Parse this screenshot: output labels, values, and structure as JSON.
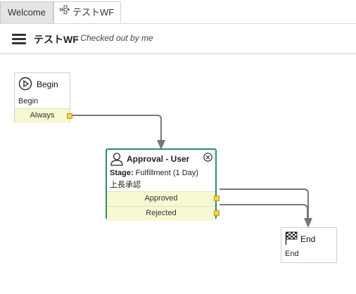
{
  "tabs": [
    {
      "label": "Welcome"
    },
    {
      "label": "テストWF"
    }
  ],
  "header": {
    "title": "テストWF",
    "subtitle": "- Checked out by me"
  },
  "nodes": {
    "begin": {
      "title": "Begin",
      "description": "Begin",
      "outcomes": [
        {
          "label": "Always"
        }
      ]
    },
    "approval": {
      "title": "Approval - User",
      "stage_label": "Stage:",
      "stage_value": " Fulfillment (1 Day)",
      "description": "上長承認",
      "outcomes": [
        {
          "label": "Approved"
        },
        {
          "label": "Rejected"
        }
      ]
    },
    "end": {
      "title": "End",
      "description": "End"
    }
  },
  "colors": {
    "accent": "#2b8a73",
    "outcome_bg": "#f8f8d2",
    "port": "#f5d33a",
    "connector": "#777777"
  },
  "icons": {
    "begin": "play-circle-icon",
    "approval": "user-icon",
    "approval_close": "close-circle-icon",
    "end": "checkered-flag-icon",
    "workflow_tab": "workflow-icon",
    "menu": "hamburger-menu-icon"
  }
}
